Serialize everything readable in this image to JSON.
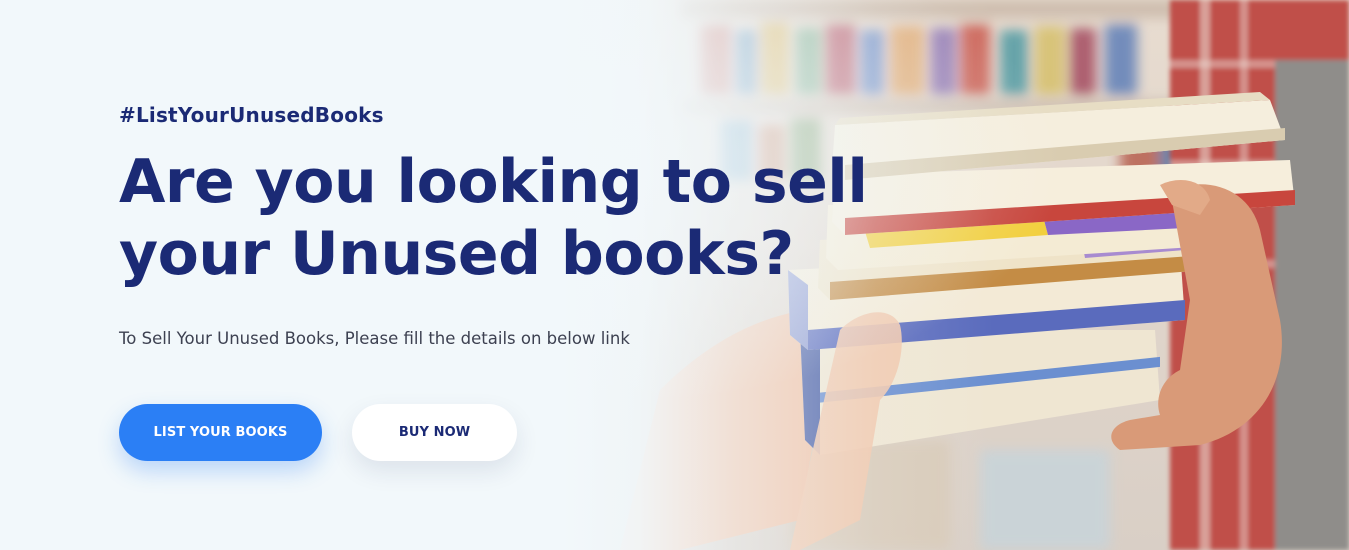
{
  "hero": {
    "hashtag": "#ListYourUnusedBooks",
    "headline": "Are you looking to sell your Unused books?",
    "subtext": "To Sell Your Unused Books, Please fill the details on below link",
    "primary_button_label": "LIST YOUR BOOKS",
    "secondary_button_label": "BUY NOW",
    "image": "hands-holding-stack-of-books-photo"
  },
  "colors": {
    "background": "#f2f8fb",
    "heading": "#1b2a75",
    "primary_button": "#2b7ff5",
    "secondary_button": "#ffffff"
  }
}
